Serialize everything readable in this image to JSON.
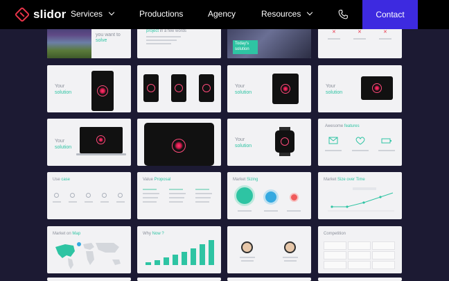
{
  "nav": {
    "logo_text": "slidor",
    "items": [
      {
        "label": "Services",
        "has_dropdown": true
      },
      {
        "label": "Productions",
        "has_dropdown": false
      },
      {
        "label": "Agency",
        "has_dropdown": false
      },
      {
        "label": "Resources",
        "has_dropdown": true
      }
    ],
    "contact_label": "Contact"
  },
  "colors": {
    "background": "#1c1a33",
    "nav": "#000000",
    "contact_button": "#3d2ae0",
    "accent": "#2ec4a3",
    "brand_red": "#e8344a"
  },
  "slides": {
    "row0": {
      "c1_text_a": "you want to",
      "c1_text_b": "solve",
      "c2_text_a": "project",
      "c2_text_b": "in a few words",
      "c3_text_a": "Today's",
      "c3_text_b": "solution"
    },
    "row1": {
      "c1_text_a": "Your",
      "c1_text_b": "solution",
      "c3_text_a": "Your",
      "c3_text_b": "solution",
      "c4_text_a": "Your",
      "c4_text_b": "solution"
    },
    "row2": {
      "c1_text_a": "Your",
      "c1_text_b": "solution",
      "c3_text_a": "Your",
      "c3_text_b": "solution",
      "c4_text_a": "Awesome",
      "c4_text_b": "features"
    },
    "row3": {
      "c1_text_a": "Use",
      "c1_text_b": "case",
      "c2_text_a": "Value",
      "c2_text_b": "Proposal",
      "c3_text_a": "Market",
      "c3_text_b": "Sizing",
      "c4_text_a": "Market",
      "c4_text_b": "Size over Time"
    },
    "row4": {
      "c1_text_a": "Market on",
      "c1_text_b": "Map",
      "c2_text_a": "Why",
      "c2_text_b": "Now ?",
      "c4_text": "Competition"
    }
  }
}
